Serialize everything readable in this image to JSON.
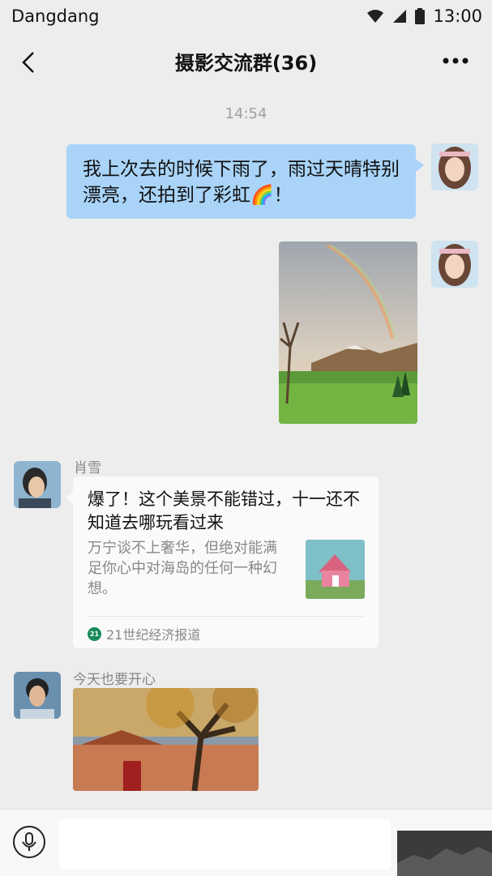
{
  "status_bar": {
    "carrier": "Dangdang",
    "time": "13:00"
  },
  "header": {
    "title": "摄影交流群(36)"
  },
  "chat": {
    "timestamp": "14:54",
    "outgoing_text": "我上次去的时候下雨了，雨过天晴特别漂亮，还拍到了彩虹🌈！",
    "card_message": {
      "sender": "肖雪",
      "headline": "爆了！这个美景不能错过，十一还不知道去哪玩看过来",
      "description": "万宁谈不上奢华，但绝对能满足你心中对海岛的任何一种幻想。",
      "source_logo": "21",
      "source": "21世纪经济报道"
    },
    "image_message": {
      "sender": "今天也要开心"
    }
  },
  "input_bar": {
    "placeholder": ""
  }
}
